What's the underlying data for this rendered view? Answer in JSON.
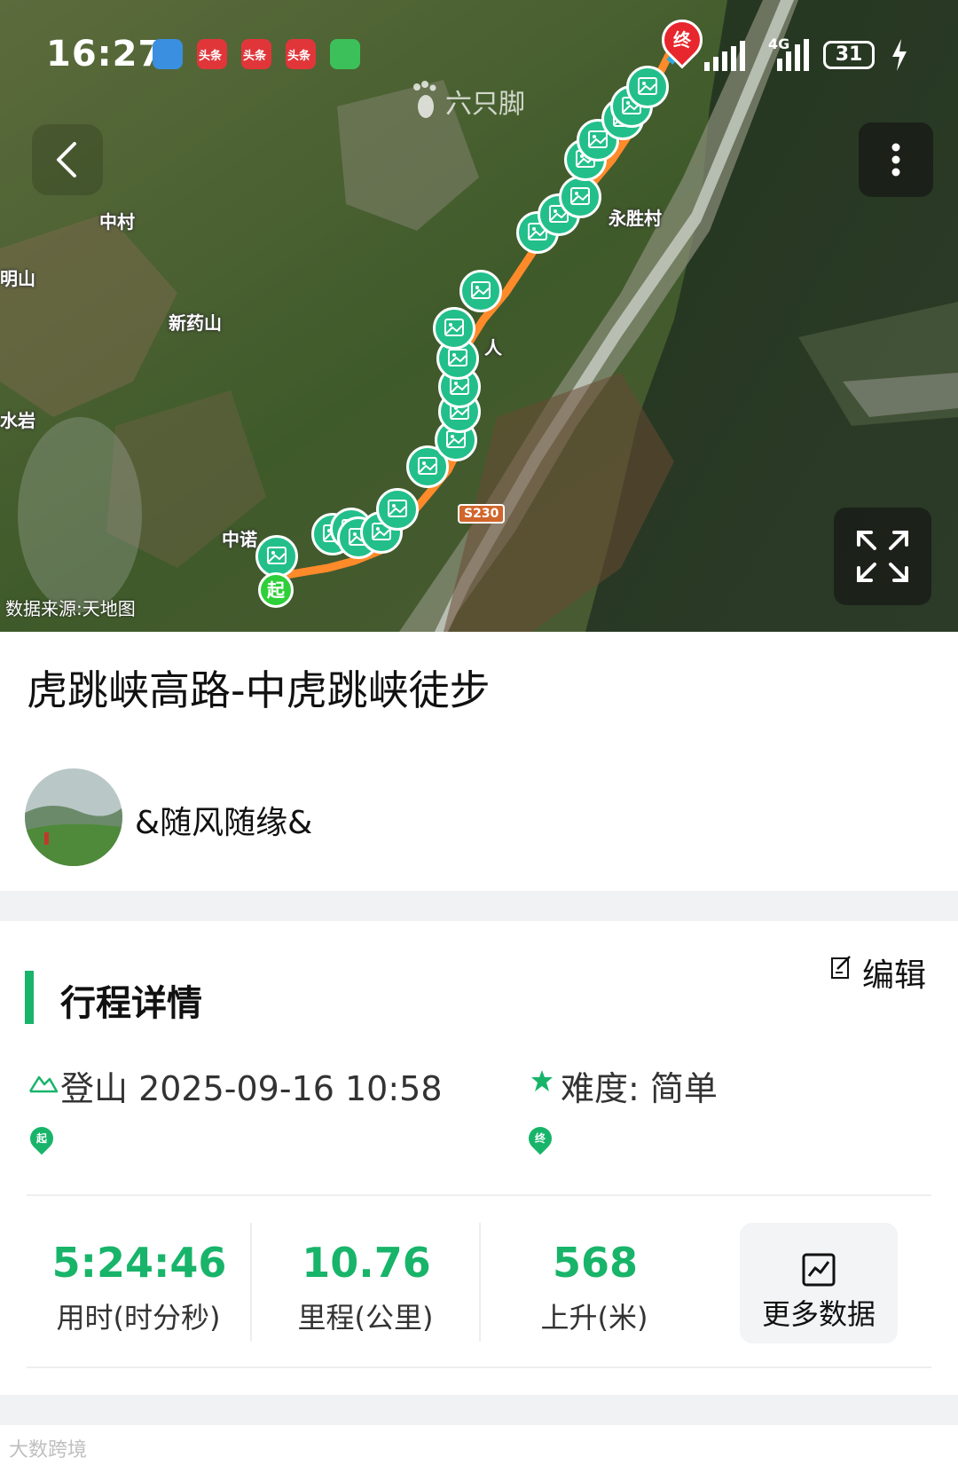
{
  "status_bar": {
    "time": "16:27",
    "notifications": [
      "头条",
      "头条",
      "头条"
    ],
    "network": "4G",
    "battery": "31"
  },
  "map": {
    "brand": "六只脚",
    "labels": {
      "zhongcun": "中村",
      "xinyaoshan": "新药山",
      "yongshengcun": "永胜村",
      "zhongnuo": "中诺",
      "mingshan": "明山",
      "shuiyan": "水岩",
      "ren": "人"
    },
    "road_sign": "S230",
    "start_marker": "起",
    "end_marker": "终",
    "data_source": "数据来源:天地图",
    "route_color": "#ff8a2a",
    "photo_marker_color": "#23bf8a"
  },
  "trip": {
    "title": "虎跳峡高路-中虎跳峡徒步",
    "user_name": "&随风随缘&"
  },
  "details": {
    "section_title": "行程详情",
    "edit_label": "编辑",
    "activity": "登山 2025-09-16 10:58",
    "difficulty": "难度:  简单",
    "start_pin": "起",
    "end_pin": "终"
  },
  "stats": [
    {
      "value": "5:24:46",
      "label": "用时(时分秒)"
    },
    {
      "value": "10.76",
      "label": "里程(公里)"
    },
    {
      "value": "568",
      "label": "上升(米)"
    }
  ],
  "more_data_label": "更多数据",
  "watermark": "大数跨境",
  "accent_color": "#18b46a"
}
